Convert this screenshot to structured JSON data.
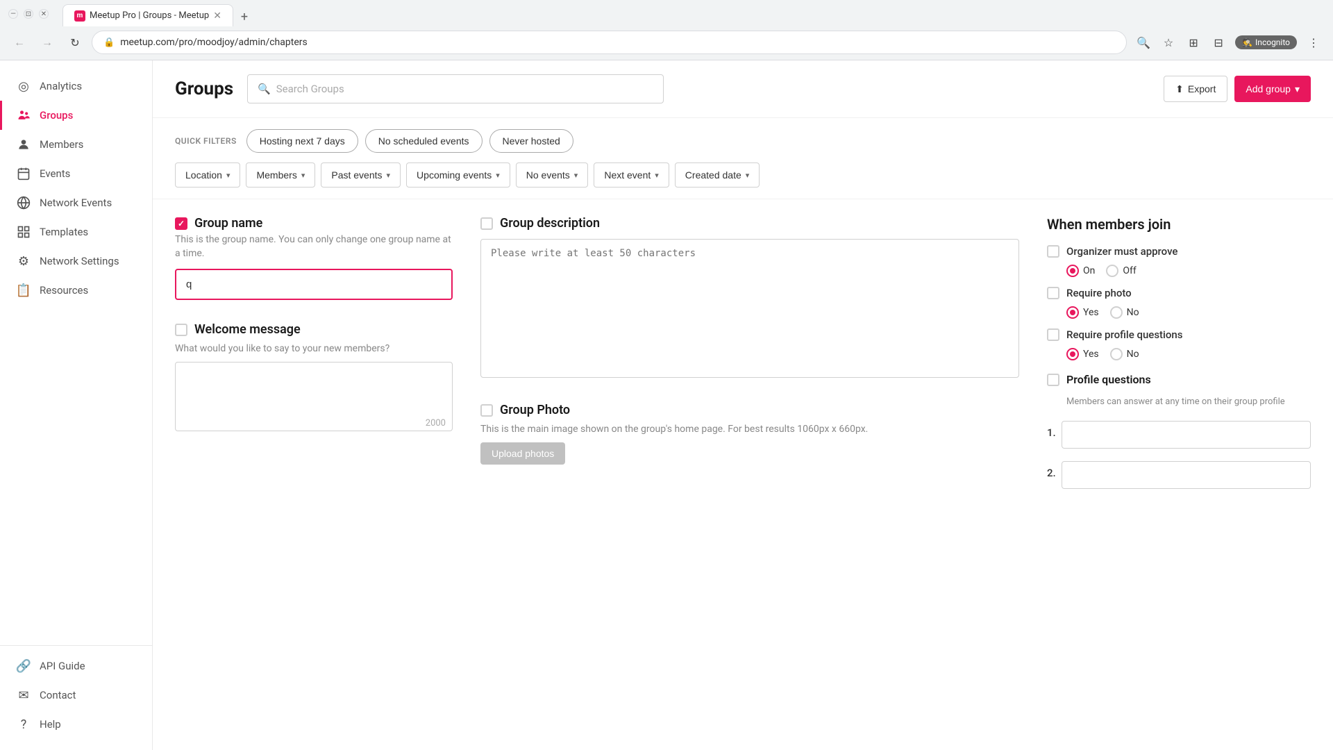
{
  "browser": {
    "tab_label": "Meetup Pro | Groups - Meetup",
    "url": "meetup.com/pro/moodjoy/admin/chapters",
    "new_tab_icon": "+",
    "back_icon": "←",
    "forward_icon": "→",
    "refresh_icon": "↻",
    "incognito_label": "Incognito",
    "star_icon": "☆",
    "puzzle_icon": "⊞",
    "profile_icon": "👤",
    "menu_icon": "⋮",
    "search_icon": "🔍",
    "split_icon": "⊟"
  },
  "sidebar": {
    "items": [
      {
        "id": "analytics",
        "label": "Analytics",
        "icon": "◎"
      },
      {
        "id": "groups",
        "label": "Groups",
        "icon": "⊕",
        "active": true
      },
      {
        "id": "members",
        "label": "Members",
        "icon": "👤"
      },
      {
        "id": "events",
        "label": "Events",
        "icon": "📅"
      },
      {
        "id": "network-events",
        "label": "Network Events",
        "icon": "🌐"
      },
      {
        "id": "templates",
        "label": "Templates",
        "icon": "⊞"
      },
      {
        "id": "network-settings",
        "label": "Network Settings",
        "icon": "⚙"
      },
      {
        "id": "resources",
        "label": "Resources",
        "icon": "📋"
      }
    ],
    "bottom_items": [
      {
        "id": "api-guide",
        "label": "API Guide",
        "icon": "🔗"
      },
      {
        "id": "contact",
        "label": "Contact",
        "icon": "✉"
      },
      {
        "id": "help",
        "label": "Help",
        "icon": "?"
      }
    ]
  },
  "header": {
    "title": "Groups",
    "search_placeholder": "Search Groups",
    "export_label": "Export",
    "add_group_label": "Add group",
    "export_icon": "⬆",
    "chevron_icon": "▾"
  },
  "filters": {
    "quick_filter_label": "QUICK FILTERS",
    "quick_filters": [
      {
        "id": "hosting-next-7",
        "label": "Hosting next 7 days"
      },
      {
        "id": "no-scheduled",
        "label": "No scheduled events"
      },
      {
        "id": "never-hosted",
        "label": "Never hosted"
      }
    ],
    "dropdowns": [
      {
        "id": "location",
        "label": "Location"
      },
      {
        "id": "members",
        "label": "Members"
      },
      {
        "id": "past-events",
        "label": "Past events"
      },
      {
        "id": "upcoming-events",
        "label": "Upcoming events"
      },
      {
        "id": "no-events",
        "label": "No events"
      },
      {
        "id": "next-event",
        "label": "Next event"
      },
      {
        "id": "created-date",
        "label": "Created date"
      }
    ]
  },
  "form": {
    "group_name": {
      "checkbox_checked": true,
      "title": "Group name",
      "description": "This is the group name. You can only change one group name at a time.",
      "value": "q",
      "placeholder": ""
    },
    "welcome_message": {
      "checkbox_checked": false,
      "title": "Welcome message",
      "placeholder": "What would you like to say to your new members?",
      "char_limit": "2000"
    },
    "group_description": {
      "checkbox_checked": false,
      "title": "Group description",
      "placeholder": "Please write at least 50 characters"
    },
    "group_photo": {
      "checkbox_checked": false,
      "title": "Group Photo",
      "description": "This is the main image shown on the group's home page. For best results 1060px x 660px.",
      "upload_label": "Upload photos"
    },
    "when_members_join": {
      "title": "When members join",
      "organizer_approve": {
        "checkbox_checked": false,
        "label": "Organizer must approve",
        "radio_on": "On",
        "radio_off": "Off",
        "selected": "on"
      },
      "require_photo": {
        "checkbox_checked": false,
        "label": "Require photo",
        "radio_yes": "Yes",
        "radio_no": "No",
        "selected": "yes"
      },
      "require_profile_questions": {
        "checkbox_checked": false,
        "label": "Require profile questions",
        "radio_yes": "Yes",
        "radio_no": "No",
        "selected": "yes"
      },
      "profile_questions": {
        "checkbox_checked": false,
        "title": "Profile questions",
        "description": "Members can answer at any time on their group profile",
        "question_1_num": "1.",
        "question_2_num": "2."
      }
    }
  }
}
